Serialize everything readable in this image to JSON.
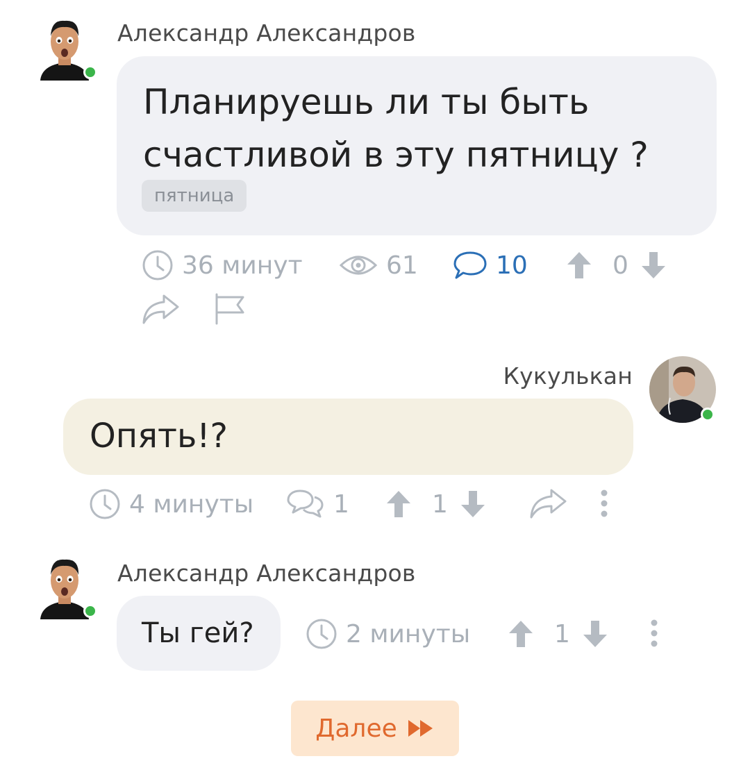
{
  "post": {
    "author": "Александр Александров",
    "text_line1": "Планируешь ли ты быть",
    "text_line2": "счастливой в эту пятницу ?",
    "tag": "пятница",
    "time": "36 минут",
    "views": "61",
    "comments": "10",
    "rating": "0"
  },
  "reply": {
    "author": "Кукулькан",
    "text": "Опять!?",
    "time": "4 минуты",
    "replies": "1",
    "rating": "1"
  },
  "comment2": {
    "author": "Александр Александров",
    "text": "Ты гей?",
    "time": "2 минуты",
    "rating": "1"
  },
  "pagination": {
    "next_label": "Далее"
  },
  "colors": {
    "online": "#3bb54a",
    "accent_blue": "#2b6fb6",
    "next_text": "#e0692e",
    "next_bg": "#fde6cf"
  }
}
